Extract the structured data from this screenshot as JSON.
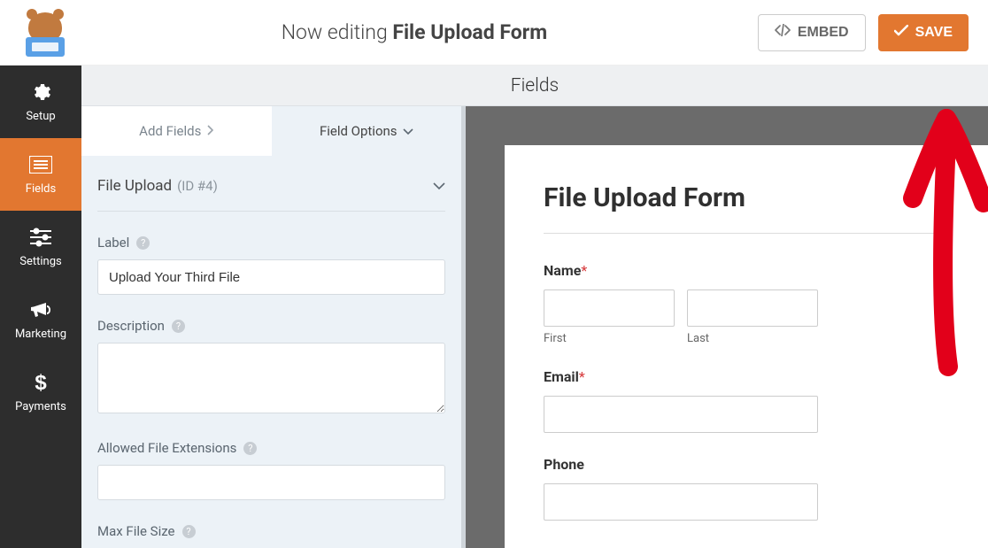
{
  "topbar": {
    "now_editing_prefix": "Now editing ",
    "form_name": "File Upload Form",
    "embed_label": "EMBED",
    "save_label": "SAVE"
  },
  "sidebar": {
    "items": [
      {
        "label": "Setup",
        "name": "setup"
      },
      {
        "label": "Fields",
        "name": "fields"
      },
      {
        "label": "Settings",
        "name": "settings"
      },
      {
        "label": "Marketing",
        "name": "marketing"
      },
      {
        "label": "Payments",
        "name": "payments"
      }
    ],
    "active_index": 1
  },
  "page_title": "Fields",
  "panel": {
    "tabs": {
      "add_fields": "Add Fields",
      "field_options": "Field Options"
    },
    "accordion": {
      "title": "File Upload",
      "id_text": "(ID #4)"
    },
    "fields": {
      "label_caption": "Label",
      "label_value": "Upload Your Third File",
      "description_caption": "Description",
      "description_value": "",
      "allowed_ext_caption": "Allowed File Extensions",
      "allowed_ext_value": "",
      "max_size_caption": "Max File Size"
    }
  },
  "preview": {
    "heading": "File Upload Form",
    "name_label": "Name",
    "first_sub": "First",
    "last_sub": "Last",
    "email_label": "Email",
    "phone_label": "Phone",
    "required_mark": "*"
  }
}
